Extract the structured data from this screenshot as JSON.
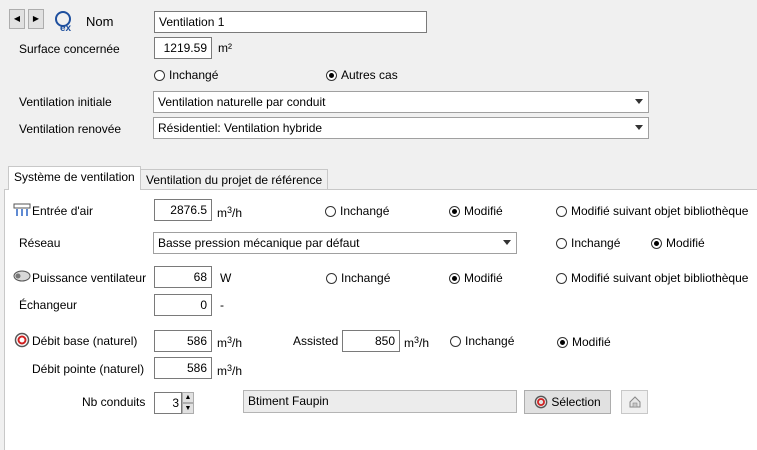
{
  "header": {
    "nom_label": "Nom",
    "nom_value": "Ventilation 1",
    "surface_label": "Surface concernée",
    "surface_value": "1219.59",
    "surface_unit": "m²",
    "opt_inchange": "Inchangé",
    "opt_autres": "Autres cas",
    "vent_init_label": "Ventilation initiale",
    "vent_init_value": "Ventilation naturelle par conduit",
    "vent_renov_label": "Ventilation renovée",
    "vent_renov_value": "Résidentiel: Ventilation hybride"
  },
  "tabs": [
    {
      "label": "Système de ventilation",
      "active": true
    },
    {
      "label": "Ventilation du projet de référence",
      "active": false
    }
  ],
  "system": {
    "entree_label": "Entrée d'air",
    "entree_value": "2876.5",
    "unit_m3h": "m",
    "unit_m3h_sup": "3",
    "unit_m3h_tail": "/h",
    "opt_inchange": "Inchangé",
    "opt_modifie": "Modifié",
    "opt_biblio": "Modifié suivant objet bibliothèque",
    "reseau_label": "Réseau",
    "reseau_value": "Basse pression mécanique par défaut",
    "puissance_label": "Puissance ventilateur",
    "puissance_value": "68",
    "puissance_unit": "W",
    "echangeur_label": "Échangeur",
    "echangeur_value": "0",
    "echangeur_unit": "-",
    "debit_base_label": "Débit base (naturel)",
    "debit_base_value": "586",
    "assisted_label": "Assisted",
    "assisted_value": "850",
    "debit_pointe_label": "Débit pointe (naturel)",
    "debit_pointe_value": "586",
    "nb_conduits_label": "Nb conduits",
    "nb_conduits_value": "3",
    "library_value": "Btiment Faupin",
    "selection_label": "Sélection"
  }
}
